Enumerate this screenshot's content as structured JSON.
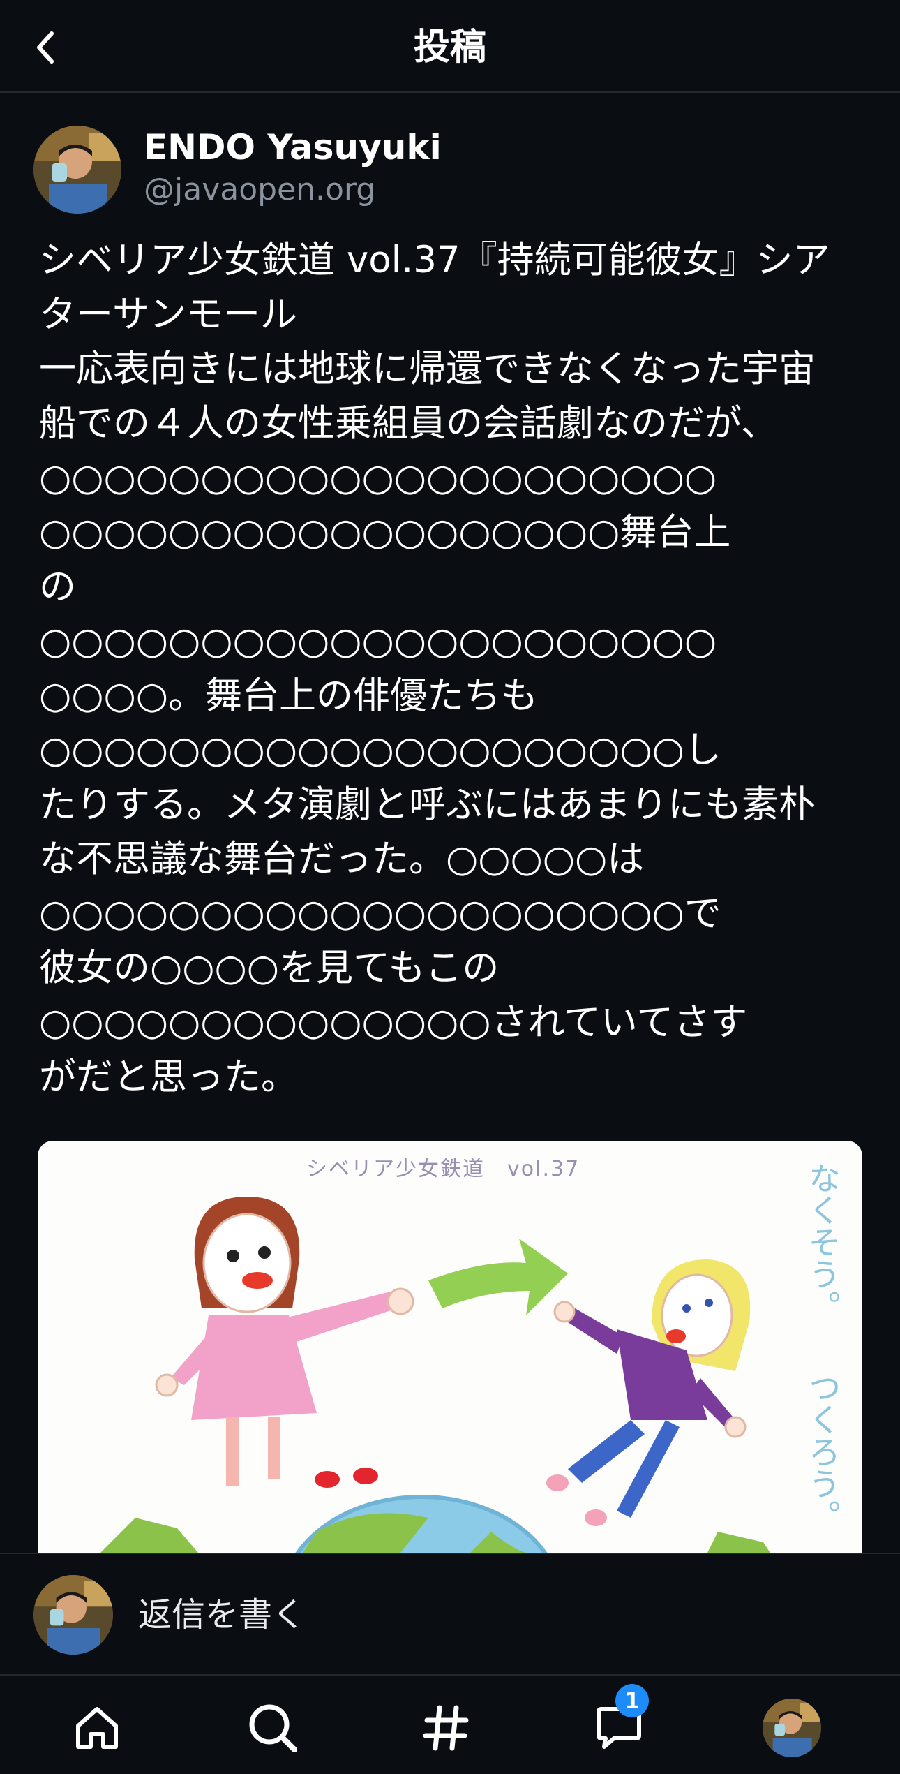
{
  "header": {
    "title": "投稿"
  },
  "post": {
    "author_name": "ENDO Yasuyuki",
    "author_handle": "@javaopen.org",
    "body_lines": [
      "シベリア少女鉄道 vol.37『持続可能彼女』シア",
      "ターサンモール",
      "一応表向きには地球に帰還できなくなった宇宙",
      "船での４人の女性乗組員の会話劇なのだが、",
      "○○○○○○○○○○○○○○○○○○○○○",
      "○○○○○○○○○○○○○○○○○○舞台上",
      "の",
      "○○○○○○○○○○○○○○○○○○○○○",
      "○○○○。舞台上の俳優たちも",
      "○○○○○○○○○○○○○○○○○○○○し",
      "たりする。メタ演劇と呼ぶにはあまりにも素朴",
      "な不思議な舞台だった。○○○○○は",
      "○○○○○○○○○○○○○○○○○○○○で",
      "彼女の○○○○を見てもこの",
      "○○○○○○○○○○○○○○されていてさす",
      "がだと思った。"
    ],
    "image": {
      "top_caption": "シベリア少女鉄道　vol.37",
      "side_caption_1": "なくそう。",
      "side_caption_2": "つくろう。"
    }
  },
  "reply": {
    "label": "返信を書く"
  },
  "tabbar": {
    "items": [
      "home-icon",
      "search-icon",
      "hashtag-icon",
      "notifications-icon",
      "profile-avatar"
    ],
    "notification_count": "1"
  },
  "colors": {
    "background": "#0a0d12",
    "badge": "#1d8cf8",
    "handle": "#8b939e",
    "divider": "#23272e"
  }
}
